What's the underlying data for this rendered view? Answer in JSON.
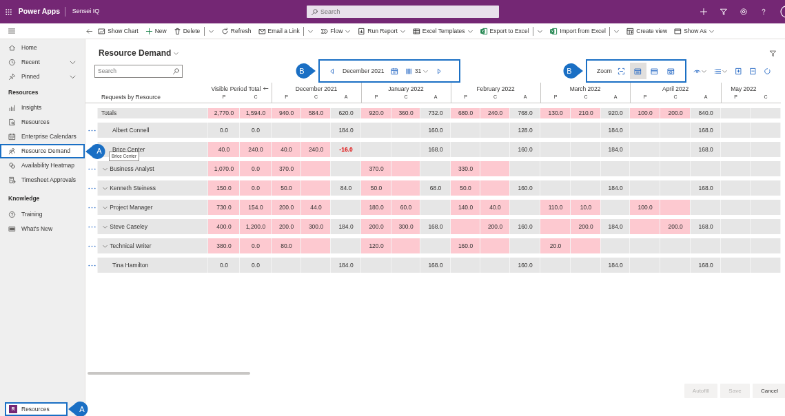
{
  "app_bar": {
    "app_name": "Power Apps",
    "environment": "Sensei IQ",
    "search": {
      "placeholder": "Search"
    }
  },
  "command_bar": {
    "items": [
      {
        "label": "Show Chart",
        "dropdown": false,
        "split": false
      },
      {
        "label": "New",
        "dropdown": false,
        "split": false
      },
      {
        "label": "Delete",
        "dropdown": false,
        "split": true
      },
      {
        "label": "Refresh",
        "dropdown": false,
        "split": false
      },
      {
        "label": "Email a Link",
        "dropdown": false,
        "split": true
      },
      {
        "label": "Flow",
        "dropdown": true,
        "split": false
      },
      {
        "label": "Run Report",
        "dropdown": true,
        "split": false
      },
      {
        "label": "Excel Templates",
        "dropdown": true,
        "split": false
      },
      {
        "label": "Export to Excel",
        "dropdown": false,
        "split": true
      },
      {
        "label": "Import from Excel",
        "dropdown": false,
        "split": true
      },
      {
        "label": "Create view",
        "dropdown": false,
        "split": false
      },
      {
        "label": "Show As",
        "dropdown": true,
        "split": false
      }
    ]
  },
  "sidebar": {
    "sections": [
      {
        "items": [
          {
            "label": "Home",
            "expandable": false,
            "selected": false
          },
          {
            "label": "Recent",
            "expandable": true,
            "selected": false
          },
          {
            "label": "Pinned",
            "expandable": true,
            "selected": false
          }
        ]
      },
      {
        "heading": "Resources",
        "items": [
          {
            "label": "Insights",
            "expandable": false,
            "selected": false
          },
          {
            "label": "Resources",
            "expandable": false,
            "selected": false
          },
          {
            "label": "Enterprise Calendars",
            "expandable": false,
            "selected": false
          },
          {
            "label": "Resource Demand",
            "expandable": false,
            "selected": true,
            "callout": "A"
          },
          {
            "label": "Availability Heatmap",
            "expandable": false,
            "selected": false
          },
          {
            "label": "Timesheet Approvals",
            "expandable": false,
            "selected": false
          }
        ]
      },
      {
        "heading": "Knowledge",
        "items": [
          {
            "label": "Training",
            "expandable": false,
            "selected": false
          },
          {
            "label": "What's New",
            "expandable": false,
            "selected": false
          }
        ]
      }
    ],
    "area_switcher": {
      "initial": "R",
      "label": "Resources",
      "callout": "A"
    }
  },
  "view": {
    "title": "Resource Demand",
    "search": {
      "placeholder": "Search"
    },
    "period": {
      "label": "December 2021",
      "days": "31",
      "callout": "B"
    },
    "zoom": {
      "label": "Zoom",
      "callout": "B",
      "options": [
        {
          "selected": false
        },
        {
          "selected": true
        },
        {
          "selected": false
        },
        {
          "selected": false
        }
      ]
    }
  },
  "grid": {
    "name_header": "Requests by Resource",
    "column_groups": [
      {
        "label": "Visible Period Total",
        "columns": [
          "P",
          "C"
        ]
      },
      {
        "label": "December 2021",
        "columns": [
          "P",
          "C",
          "A"
        ]
      },
      {
        "label": "January 2022",
        "columns": [
          "P",
          "C",
          "A"
        ]
      },
      {
        "label": "February 2022",
        "columns": [
          "P",
          "C",
          "A"
        ]
      },
      {
        "label": "March 2022",
        "columns": [
          "P",
          "C",
          "A"
        ]
      },
      {
        "label": "April 2022",
        "columns": [
          "P",
          "C",
          "A"
        ]
      },
      {
        "label": "May 2022",
        "columns": [
          "P",
          "C"
        ]
      }
    ],
    "rows": [
      {
        "kind": "total",
        "name": "Totals",
        "expandable": false,
        "menu": false,
        "cells": [
          {
            "text": "2,770.0",
            "highlighted": true
          },
          {
            "text": "1,594.0",
            "highlighted": true
          },
          {
            "text": "940.0",
            "highlighted": true
          },
          {
            "text": "584.0",
            "highlighted": true
          },
          {
            "text": "620.0",
            "highlighted": false
          },
          {
            "text": "920.0",
            "highlighted": true
          },
          {
            "text": "360.0",
            "highlighted": true
          },
          {
            "text": "732.0",
            "highlighted": false
          },
          {
            "text": "680.0",
            "highlighted": true
          },
          {
            "text": "240.0",
            "highlighted": true
          },
          {
            "text": "768.0",
            "highlighted": false
          },
          {
            "text": "130.0",
            "highlighted": true
          },
          {
            "text": "210.0",
            "highlighted": true
          },
          {
            "text": "920.0",
            "highlighted": false
          },
          {
            "text": "100.0",
            "highlighted": true
          },
          {
            "text": "200.0",
            "highlighted": true
          },
          {
            "text": "840.0",
            "highlighted": false
          },
          {
            "highlighted": false
          },
          {
            "highlighted": false
          }
        ]
      },
      {
        "kind": "item",
        "name": "Albert Connell",
        "expandable": false,
        "menu": true,
        "cells": [
          {
            "text": "0.0",
            "highlighted": false
          },
          {
            "text": "0.0",
            "highlighted": false
          },
          {
            "highlighted": false
          },
          {
            "highlighted": false
          },
          {
            "text": "184.0",
            "highlighted": false
          },
          {
            "highlighted": false
          },
          {
            "highlighted": false
          },
          {
            "text": "160.0",
            "highlighted": false
          },
          {
            "highlighted": false
          },
          {
            "highlighted": false
          },
          {
            "text": "128.0",
            "highlighted": false
          },
          {
            "highlighted": false
          },
          {
            "highlighted": false
          },
          {
            "text": "184.0",
            "highlighted": false
          },
          {
            "highlighted": false
          },
          {
            "highlighted": false
          },
          {
            "text": "168.0",
            "highlighted": false
          },
          {
            "highlighted": false
          },
          {
            "highlighted": false
          }
        ]
      },
      {
        "kind": "item",
        "name": "Brice Center",
        "expandable": false,
        "menu": false,
        "tooltip": "Brice Center",
        "cells": [
          {
            "text": "40.0",
            "highlighted": true
          },
          {
            "text": "240.0",
            "highlighted": true
          },
          {
            "text": "40.0",
            "highlighted": true
          },
          {
            "text": "240.0",
            "highlighted": true
          },
          {
            "text": "-16.0",
            "highlighted": false,
            "alert": true
          },
          {
            "highlighted": false
          },
          {
            "highlighted": false
          },
          {
            "text": "168.0",
            "highlighted": false
          },
          {
            "highlighted": false
          },
          {
            "highlighted": false
          },
          {
            "text": "160.0",
            "highlighted": false
          },
          {
            "highlighted": false
          },
          {
            "highlighted": false
          },
          {
            "text": "184.0",
            "highlighted": false
          },
          {
            "highlighted": false
          },
          {
            "highlighted": false
          },
          {
            "text": "168.0",
            "highlighted": false
          },
          {
            "highlighted": false
          },
          {
            "highlighted": false
          }
        ]
      },
      {
        "kind": "item",
        "name": "Business Analyst",
        "expandable": true,
        "menu": true,
        "cells": [
          {
            "text": "1,070.0",
            "highlighted": true
          },
          {
            "text": "0.0",
            "highlighted": true
          },
          {
            "text": "370.0",
            "highlighted": true
          },
          {
            "highlighted": true
          },
          {
            "highlighted": false
          },
          {
            "text": "370.0",
            "highlighted": true
          },
          {
            "highlighted": true
          },
          {
            "highlighted": false
          },
          {
            "text": "330.0",
            "highlighted": true
          },
          {
            "highlighted": true
          },
          {
            "highlighted": false
          },
          {
            "highlighted": false
          },
          {
            "highlighted": false
          },
          {
            "highlighted": false
          },
          {
            "highlighted": false
          },
          {
            "highlighted": false
          },
          {
            "highlighted": false
          },
          {
            "highlighted": false
          },
          {
            "highlighted": false
          }
        ]
      },
      {
        "kind": "item",
        "name": "Kenneth Steiness",
        "expandable": true,
        "menu": true,
        "cells": [
          {
            "text": "150.0",
            "highlighted": true
          },
          {
            "text": "0.0",
            "highlighted": true
          },
          {
            "text": "50.0",
            "highlighted": true
          },
          {
            "highlighted": true
          },
          {
            "text": "84.0",
            "highlighted": false
          },
          {
            "text": "50.0",
            "highlighted": true
          },
          {
            "highlighted": true
          },
          {
            "text": "68.0",
            "highlighted": false
          },
          {
            "text": "50.0",
            "highlighted": true
          },
          {
            "highlighted": true
          },
          {
            "text": "160.0",
            "highlighted": false
          },
          {
            "highlighted": false
          },
          {
            "highlighted": false
          },
          {
            "text": "184.0",
            "highlighted": false
          },
          {
            "highlighted": false
          },
          {
            "highlighted": false
          },
          {
            "text": "168.0",
            "highlighted": false
          },
          {
            "highlighted": false
          },
          {
            "highlighted": false
          }
        ]
      },
      {
        "kind": "item",
        "name": "Project Manager",
        "expandable": true,
        "menu": true,
        "cells": [
          {
            "text": "730.0",
            "highlighted": true
          },
          {
            "text": "154.0",
            "highlighted": true
          },
          {
            "text": "200.0",
            "highlighted": true
          },
          {
            "text": "44.0",
            "highlighted": true
          },
          {
            "highlighted": false
          },
          {
            "text": "180.0",
            "highlighted": true
          },
          {
            "text": "60.0",
            "highlighted": true
          },
          {
            "highlighted": false
          },
          {
            "text": "140.0",
            "highlighted": true
          },
          {
            "text": "40.0",
            "highlighted": true
          },
          {
            "highlighted": false
          },
          {
            "text": "110.0",
            "highlighted": true
          },
          {
            "text": "10.0",
            "highlighted": true
          },
          {
            "highlighted": false
          },
          {
            "text": "100.0",
            "highlighted": true
          },
          {
            "highlighted": true
          },
          {
            "highlighted": false
          },
          {
            "highlighted": false
          },
          {
            "highlighted": false
          }
        ]
      },
      {
        "kind": "item",
        "name": "Steve Caseley",
        "expandable": true,
        "menu": true,
        "cells": [
          {
            "text": "400.0",
            "highlighted": true
          },
          {
            "text": "1,200.0",
            "highlighted": true
          },
          {
            "text": "200.0",
            "highlighted": true
          },
          {
            "text": "300.0",
            "highlighted": true
          },
          {
            "text": "184.0",
            "highlighted": false
          },
          {
            "text": "200.0",
            "highlighted": true
          },
          {
            "text": "300.0",
            "highlighted": true
          },
          {
            "text": "168.0",
            "highlighted": false
          },
          {
            "highlighted": true
          },
          {
            "text": "200.0",
            "highlighted": true
          },
          {
            "text": "160.0",
            "highlighted": false
          },
          {
            "highlighted": true
          },
          {
            "text": "200.0",
            "highlighted": true
          },
          {
            "text": "184.0",
            "highlighted": false
          },
          {
            "highlighted": true
          },
          {
            "text": "200.0",
            "highlighted": true
          },
          {
            "text": "168.0",
            "highlighted": false
          },
          {
            "highlighted": false
          },
          {
            "highlighted": false
          }
        ]
      },
      {
        "kind": "item",
        "name": "Technical Writer",
        "expandable": true,
        "menu": true,
        "cells": [
          {
            "text": "380.0",
            "highlighted": true
          },
          {
            "text": "0.0",
            "highlighted": true
          },
          {
            "text": "80.0",
            "highlighted": true
          },
          {
            "highlighted": true
          },
          {
            "highlighted": false
          },
          {
            "text": "120.0",
            "highlighted": true
          },
          {
            "highlighted": true
          },
          {
            "highlighted": false
          },
          {
            "text": "160.0",
            "highlighted": true
          },
          {
            "highlighted": true
          },
          {
            "highlighted": false
          },
          {
            "text": "20.0",
            "highlighted": true
          },
          {
            "highlighted": true
          },
          {
            "highlighted": false
          },
          {
            "highlighted": false
          },
          {
            "highlighted": false
          },
          {
            "highlighted": false
          },
          {
            "highlighted": false
          },
          {
            "highlighted": false
          }
        ]
      },
      {
        "kind": "item",
        "name": "Tina Hamilton",
        "expandable": false,
        "menu": true,
        "cells": [
          {
            "text": "0.0",
            "highlighted": false
          },
          {
            "text": "0.0",
            "highlighted": false
          },
          {
            "highlighted": false
          },
          {
            "highlighted": false
          },
          {
            "text": "184.0",
            "highlighted": false
          },
          {
            "highlighted": false
          },
          {
            "highlighted": false
          },
          {
            "text": "168.0",
            "highlighted": false
          },
          {
            "highlighted": false
          },
          {
            "highlighted": false
          },
          {
            "text": "160.0",
            "highlighted": false
          },
          {
            "highlighted": false
          },
          {
            "highlighted": false
          },
          {
            "text": "184.0",
            "highlighted": false
          },
          {
            "highlighted": false
          },
          {
            "highlighted": false
          },
          {
            "text": "168.0",
            "highlighted": false
          },
          {
            "highlighted": false
          },
          {
            "highlighted": false
          }
        ]
      }
    ]
  },
  "footer": {
    "buttons": [
      {
        "label": "Autofill",
        "disabled": true
      },
      {
        "label": "Save",
        "disabled": true
      },
      {
        "label": "Cancel",
        "disabled": false
      }
    ]
  }
}
